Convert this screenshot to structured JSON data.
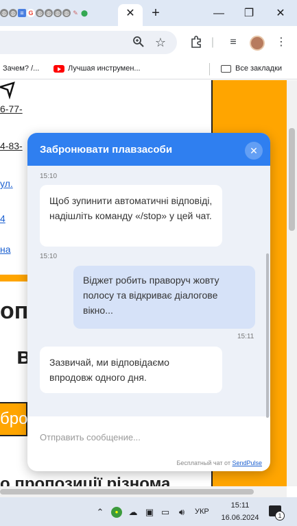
{
  "browser": {
    "close_tab_glyph": "✕",
    "new_tab_glyph": "+",
    "window_buttons": [
      "—",
      "❐",
      "✕"
    ],
    "tab_favicons": [
      "globe-icon",
      "globe-icon",
      "docs-icon",
      "google-icon",
      "globe-icon",
      "globe-icon",
      "globe-icon",
      "globe-icon",
      "pencil-icon",
      "maps-icon"
    ]
  },
  "bookmarks": {
    "item1": "Зачем? /...",
    "item2": "Лучшая инструмен...",
    "all_bookmarks": "Все закладки"
  },
  "page": {
    "phone1": "6-77-",
    "phone2": "4-83-",
    "link1": "ул.",
    "link2": "4",
    "link3": "на",
    "big1": "оп",
    "big2": "в",
    "orange_button_fragment": "бро",
    "bottom": "о пропозиції різнома"
  },
  "chat": {
    "title": "Забронювати плавзасоби",
    "close_glyph": "✕",
    "messages": [
      {
        "time": "15:10"
      },
      {
        "text": "Щоб зупинити автоматичні відповіді, надішліть команду «/stop» у цей чат.",
        "time": "15:10",
        "from": "bot"
      },
      {
        "text": "Віджет робить праворуч жовту полосу та відкриває діалогове вікно...",
        "time": "15:11",
        "from": "user"
      },
      {
        "text": "Зазвичай, ми відповідаємо впродовж одного дня.",
        "from": "bot"
      }
    ],
    "input_placeholder": "Отправить сообщение...",
    "footer_prefix": "Бесплатный чат от",
    "footer_link": "SendPulse"
  },
  "taskbar": {
    "language": "УКР",
    "time": "15:11",
    "date": "16.06.2024",
    "notification_count": "1"
  },
  "colors": {
    "accent": "#2f7ff0",
    "page_orange": "#ffa500"
  }
}
